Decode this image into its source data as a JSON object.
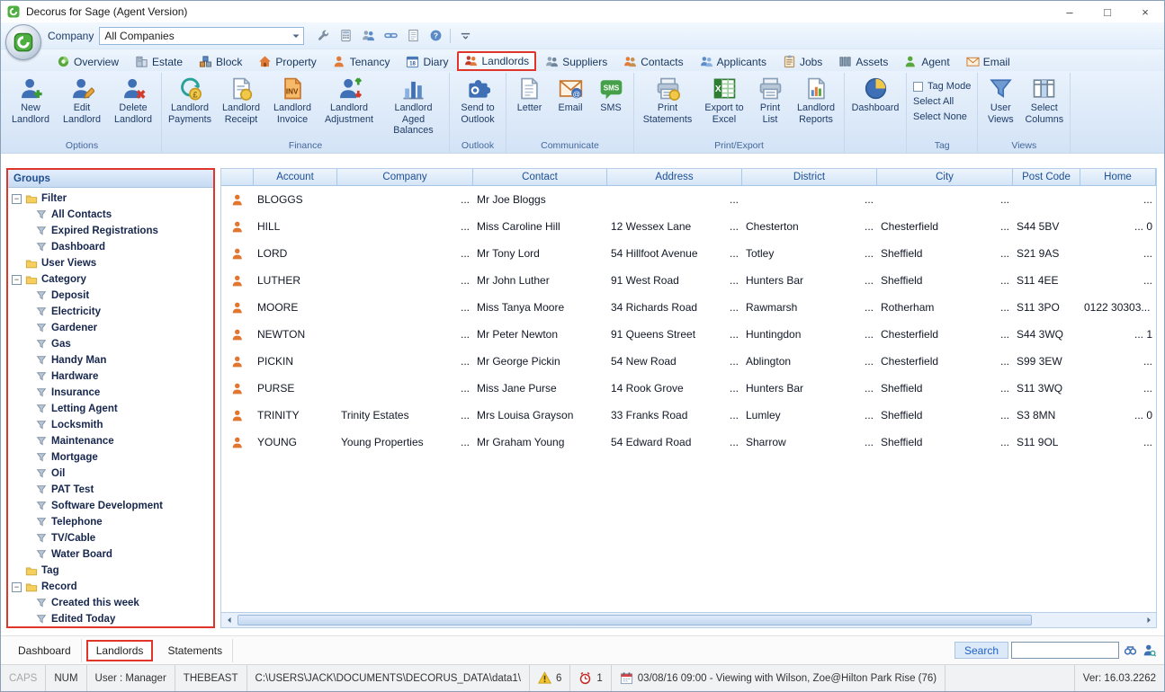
{
  "window": {
    "title": "Decorus for Sage (Agent Version)",
    "controls": {
      "minimize": "–",
      "maximize": "□",
      "close": "×"
    }
  },
  "toolbar": {
    "company_label": "Company",
    "company_value": "All Companies",
    "icons": [
      "wrench-icon",
      "calculator-icon",
      "team-icon",
      "link-icon",
      "notes-icon",
      "help-icon"
    ]
  },
  "ribbon_tabs": [
    {
      "label": "Overview",
      "icon": "overview-icon"
    },
    {
      "label": "Estate",
      "icon": "estate-icon"
    },
    {
      "label": "Block",
      "icon": "block-icon"
    },
    {
      "label": "Property",
      "icon": "property-icon"
    },
    {
      "label": "Tenancy",
      "icon": "tenancy-icon"
    },
    {
      "label": "Diary",
      "icon": "diary-icon"
    },
    {
      "label": "Landlords",
      "icon": "landlords-icon",
      "active": true,
      "highlighted": true
    },
    {
      "label": "Suppliers",
      "icon": "suppliers-icon"
    },
    {
      "label": "Contacts",
      "icon": "contacts-icon"
    },
    {
      "label": "Applicants",
      "icon": "applicants-icon"
    },
    {
      "label": "Jobs",
      "icon": "jobs-icon"
    },
    {
      "label": "Assets",
      "icon": "assets-icon"
    },
    {
      "label": "Agent",
      "icon": "agent-icon"
    },
    {
      "label": "Email",
      "icon": "email-tab-icon"
    }
  ],
  "ribbon": {
    "groups": [
      {
        "caption": "Options",
        "buttons": [
          {
            "label": "New Landlord",
            "icon": "person-add-icon"
          },
          {
            "label": "Edit Landlord",
            "icon": "person-edit-icon"
          },
          {
            "label": "Delete Landlord",
            "icon": "person-delete-icon"
          }
        ]
      },
      {
        "caption": "Finance",
        "buttons": [
          {
            "label": "Landlord Payments",
            "icon": "payments-icon"
          },
          {
            "label": "Landlord Receipt",
            "icon": "receipt-icon"
          },
          {
            "label": "Landlord Invoice",
            "icon": "invoice-icon"
          },
          {
            "label": "Landlord Adjustment",
            "icon": "adjustment-icon"
          },
          {
            "label": "Landlord Aged Balances",
            "icon": "aged-balances-icon"
          }
        ]
      },
      {
        "caption": "Outlook",
        "buttons": [
          {
            "label": "Send to Outlook",
            "icon": "outlook-icon"
          }
        ]
      },
      {
        "caption": "Communicate",
        "buttons": [
          {
            "label": "Letter",
            "icon": "letter-icon"
          },
          {
            "label": "Email",
            "icon": "email-icon"
          },
          {
            "label": "SMS",
            "icon": "sms-icon"
          }
        ]
      },
      {
        "caption": "Print/Export",
        "buttons": [
          {
            "label": "Print Statements",
            "icon": "print-statements-icon"
          },
          {
            "label": "Export to Excel",
            "icon": "excel-icon"
          },
          {
            "label": "Print List",
            "icon": "print-list-icon"
          },
          {
            "label": "Landlord Reports",
            "icon": "reports-icon"
          }
        ]
      },
      {
        "caption": "",
        "buttons": [
          {
            "label": "Dashboard",
            "icon": "dashboard-icon"
          }
        ]
      },
      {
        "caption": "Tag",
        "stack": [
          {
            "label": "Tag Mode",
            "control": "checkbox",
            "checked": false
          },
          {
            "label": "Select All",
            "control": "button"
          },
          {
            "label": "Select None",
            "control": "button"
          }
        ]
      },
      {
        "caption": "Views",
        "buttons": [
          {
            "label": "User Views",
            "icon": "user-views-icon"
          },
          {
            "label": "Select Columns",
            "icon": "select-columns-icon"
          }
        ]
      }
    ]
  },
  "sidebar": {
    "header": "Groups",
    "tree": [
      {
        "label": "Filter",
        "type": "folder",
        "level": 0,
        "expand": "minus"
      },
      {
        "label": "All Contacts",
        "type": "item",
        "level": 1,
        "selected": true
      },
      {
        "label": "Expired Registrations",
        "type": "item",
        "level": 1
      },
      {
        "label": "Dashboard",
        "type": "item",
        "level": 1
      },
      {
        "label": "User Views",
        "type": "folder",
        "level": 0
      },
      {
        "label": "Category",
        "type": "folder",
        "level": 0,
        "expand": "minus"
      },
      {
        "label": "Deposit",
        "type": "item",
        "level": 1
      },
      {
        "label": "Electricity",
        "type": "item",
        "level": 1
      },
      {
        "label": "Gardener",
        "type": "item",
        "level": 1
      },
      {
        "label": "Gas",
        "type": "item",
        "level": 1
      },
      {
        "label": "Handy Man",
        "type": "item",
        "level": 1
      },
      {
        "label": "Hardware",
        "type": "item",
        "level": 1
      },
      {
        "label": "Insurance",
        "type": "item",
        "level": 1
      },
      {
        "label": "Letting Agent",
        "type": "item",
        "level": 1
      },
      {
        "label": "Locksmith",
        "type": "item",
        "level": 1
      },
      {
        "label": "Maintenance",
        "type": "item",
        "level": 1
      },
      {
        "label": "Mortgage",
        "type": "item",
        "level": 1
      },
      {
        "label": "Oil",
        "type": "item",
        "level": 1
      },
      {
        "label": "PAT Test",
        "type": "item",
        "level": 1
      },
      {
        "label": "Software Development",
        "type": "item",
        "level": 1
      },
      {
        "label": "Telephone",
        "type": "item",
        "level": 1
      },
      {
        "label": "TV/Cable",
        "type": "item",
        "level": 1
      },
      {
        "label": "Water Board",
        "type": "item",
        "level": 1
      },
      {
        "label": "Tag",
        "type": "folder",
        "level": 0
      },
      {
        "label": "Record",
        "type": "folder",
        "level": 0,
        "expand": "minus"
      },
      {
        "label": "Created this week",
        "type": "item",
        "level": 1
      },
      {
        "label": "Edited Today",
        "type": "item",
        "level": 1
      }
    ]
  },
  "table": {
    "columns": [
      "Account",
      "Company",
      "Contact",
      "Address",
      "District",
      "City",
      "Post Code",
      "Home"
    ],
    "truncation_marker": "...",
    "truncated_columns": [
      "Company",
      "Address",
      "District",
      "City"
    ],
    "rows": [
      {
        "account": "BLOGGS",
        "company": "",
        "contact": "Mr Joe Bloggs",
        "address": "",
        "district": "",
        "city": "",
        "postcode": "",
        "home": "",
        "home_right": "..."
      },
      {
        "account": "HILL",
        "company": "",
        "contact": "Miss Caroline Hill",
        "address": "12 Wessex Lane",
        "district": "Chesterton",
        "city": "Chesterfield",
        "postcode": "S44 5BV",
        "home": "",
        "home_right": "... 0"
      },
      {
        "account": "LORD",
        "company": "",
        "contact": "Mr Tony Lord",
        "address": "54 Hillfoot Avenue",
        "district": "Totley",
        "city": "Sheffield",
        "postcode": "S21 9AS",
        "home": "",
        "home_right": "..."
      },
      {
        "account": "LUTHER",
        "company": "",
        "contact": "Mr John Luther",
        "address": "91 West Road",
        "district": "Hunters Bar",
        "city": "Sheffield",
        "postcode": "S11 4EE",
        "home": "",
        "home_right": "..."
      },
      {
        "account": "MOORE",
        "company": "",
        "contact": "Miss Tanya Moore",
        "address": "34 Richards Road",
        "district": "Rawmarsh",
        "city": "Rotherham",
        "postcode": "S11 3PO",
        "home": "0122 30303...",
        "home_right": ""
      },
      {
        "account": "NEWTON",
        "company": "",
        "contact": "Mr Peter Newton",
        "address": "91 Queens Street",
        "district": "Huntingdon",
        "city": "Chesterfield",
        "postcode": "S44 3WQ",
        "home": "",
        "home_right": "... 1"
      },
      {
        "account": "PICKIN",
        "company": "",
        "contact": "Mr George Pickin",
        "address": "54 New Road",
        "district": "Ablington",
        "city": "Chesterfield",
        "postcode": "S99 3EW",
        "home": "",
        "home_right": "..."
      },
      {
        "account": "PURSE",
        "company": "",
        "contact": "Miss Jane Purse",
        "address": "14 Rook Grove",
        "district": "Hunters Bar",
        "city": "Sheffield",
        "postcode": "S11 3WQ",
        "home": "",
        "home_right": "..."
      },
      {
        "account": "TRINITY",
        "company": "Trinity Estates",
        "contact": "Mrs Louisa Grayson",
        "address": "33 Franks Road",
        "district": "Lumley",
        "city": "Sheffield",
        "postcode": "S3 8MN",
        "home": "",
        "home_right": "... 0"
      },
      {
        "account": "YOUNG",
        "company": "Young Properties",
        "contact": "Mr Graham Young",
        "address": "54 Edward Road",
        "district": "Sharrow",
        "city": "Sheffield",
        "postcode": "S11 9OL",
        "home": "",
        "home_right": "..."
      }
    ]
  },
  "bottom_tabs": [
    {
      "label": "Dashboard"
    },
    {
      "label": "Landlords",
      "active": true,
      "highlighted": true
    },
    {
      "label": "Statements"
    }
  ],
  "search": {
    "label": "Search",
    "value": ""
  },
  "status_bar": {
    "caps": "CAPS",
    "num": "NUM",
    "user": "User : Manager",
    "machine": "THEBEAST",
    "path": "C:\\USERS\\JACK\\DOCUMENTS\\DECORUS_DATA\\data1\\",
    "warnings": "6",
    "alarms": "1",
    "message": "03/08/16 09:00 - Viewing with Wilson, Zoe@Hilton Park Rise (76)",
    "version": "Ver: 16.03.2262"
  }
}
